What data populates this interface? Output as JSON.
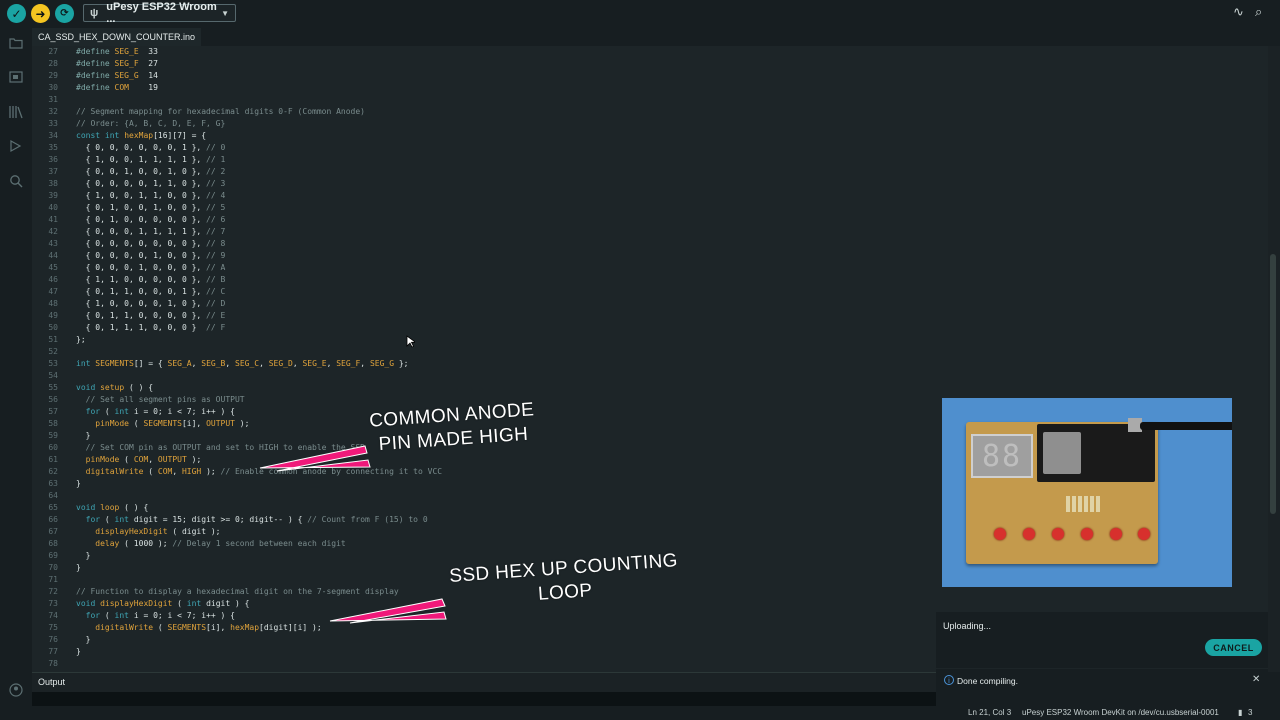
{
  "toolbar": {
    "verify_icon": "check-icon",
    "upload_icon": "arrow-right-icon",
    "debug_icon": "debug-icon",
    "board": "uPesy ESP32 Wroom ...",
    "colors": {
      "verify": "#1aa4a3",
      "upload": "#f5c521",
      "debug": "#1aa4a3"
    }
  },
  "tab": {
    "filename": "CA_SSD_HEX_DOWN_COUNTER.ino"
  },
  "code": {
    "lines": [
      {
        "n": "27",
        "t": "#define SEG_E  33"
      },
      {
        "n": "28",
        "t": "#define SEG_F  27"
      },
      {
        "n": "29",
        "t": "#define SEG_G  14"
      },
      {
        "n": "30",
        "t": "#define COM    19"
      },
      {
        "n": "31",
        "t": ""
      },
      {
        "n": "32",
        "t": "// Segment mapping for hexadecimal digits 0-F (Common Anode)"
      },
      {
        "n": "33",
        "t": "// Order: {A, B, C, D, E, F, G}"
      },
      {
        "n": "34",
        "t": "const int hexMap[16][7] = {"
      },
      {
        "n": "35",
        "t": "  { 0, 0, 0, 0, 0, 0, 1 }, // 0"
      },
      {
        "n": "36",
        "t": "  { 1, 0, 0, 1, 1, 1, 1 }, // 1"
      },
      {
        "n": "37",
        "t": "  { 0, 0, 1, 0, 0, 1, 0 }, // 2"
      },
      {
        "n": "38",
        "t": "  { 0, 0, 0, 0, 1, 1, 0 }, // 3"
      },
      {
        "n": "39",
        "t": "  { 1, 0, 0, 1, 1, 0, 0 }, // 4"
      },
      {
        "n": "40",
        "t": "  { 0, 1, 0, 0, 1, 0, 0 }, // 5"
      },
      {
        "n": "41",
        "t": "  { 0, 1, 0, 0, 0, 0, 0 }, // 6"
      },
      {
        "n": "42",
        "t": "  { 0, 0, 0, 1, 1, 1, 1 }, // 7"
      },
      {
        "n": "43",
        "t": "  { 0, 0, 0, 0, 0, 0, 0 }, // 8"
      },
      {
        "n": "44",
        "t": "  { 0, 0, 0, 0, 1, 0, 0 }, // 9"
      },
      {
        "n": "45",
        "t": "  { 0, 0, 0, 1, 0, 0, 0 }, // A"
      },
      {
        "n": "46",
        "t": "  { 1, 1, 0, 0, 0, 0, 0 }, // B"
      },
      {
        "n": "47",
        "t": "  { 0, 1, 1, 0, 0, 0, 1 }, // C"
      },
      {
        "n": "48",
        "t": "  { 1, 0, 0, 0, 0, 1, 0 }, // D"
      },
      {
        "n": "49",
        "t": "  { 0, 1, 1, 0, 0, 0, 0 }, // E"
      },
      {
        "n": "50",
        "t": "  { 0, 1, 1, 1, 0, 0, 0 }  // F"
      },
      {
        "n": "51",
        "t": "};"
      },
      {
        "n": "52",
        "t": ""
      },
      {
        "n": "53",
        "t": "int SEGMENTS[] = { SEG_A, SEG_B, SEG_C, SEG_D, SEG_E, SEG_F, SEG_G };"
      },
      {
        "n": "54",
        "t": ""
      },
      {
        "n": "55",
        "t": "void setup ( ) {"
      },
      {
        "n": "56",
        "t": "  // Set all segment pins as OUTPUT"
      },
      {
        "n": "57",
        "t": "  for ( int i = 0; i < 7; i++ ) {"
      },
      {
        "n": "58",
        "t": "    pinMode ( SEGMENTS[i], OUTPUT );"
      },
      {
        "n": "59",
        "t": "  }"
      },
      {
        "n": "60",
        "t": "  // Set COM pin as OUTPUT and set to HIGH to enable the SSD"
      },
      {
        "n": "61",
        "t": "  pinMode ( COM, OUTPUT );"
      },
      {
        "n": "62",
        "t": "  digitalWrite ( COM, HIGH ); // Enable common anode by connecting it to VCC"
      },
      {
        "n": "63",
        "t": "}"
      },
      {
        "n": "64",
        "t": ""
      },
      {
        "n": "65",
        "t": "void loop ( ) {"
      },
      {
        "n": "66",
        "t": "  for ( int digit = 15; digit >= 0; digit-- ) { // Count from F (15) to 0"
      },
      {
        "n": "67",
        "t": "    displayHexDigit ( digit );"
      },
      {
        "n": "68",
        "t": "    delay ( 1000 ); // Delay 1 second between each digit"
      },
      {
        "n": "69",
        "t": "  }"
      },
      {
        "n": "70",
        "t": "}"
      },
      {
        "n": "71",
        "t": ""
      },
      {
        "n": "72",
        "t": "// Function to display a hexadecimal digit on the 7-segment display"
      },
      {
        "n": "73",
        "t": "void displayHexDigit ( int digit ) {"
      },
      {
        "n": "74",
        "t": "  for ( int i = 0; i < 7; i++ ) {"
      },
      {
        "n": "75",
        "t": "    digitalWrite ( SEGMENTS[i], hexMap[digit][i] );"
      },
      {
        "n": "76",
        "t": "  }"
      },
      {
        "n": "77",
        "t": "}"
      },
      {
        "n": "78",
        "t": ""
      }
    ]
  },
  "annotations": {
    "anode_line1": "COMMON ANODE",
    "anode_line2": "PIN MADE HIGH",
    "loop_line1": "SSD HEX UP COUNTING",
    "loop_line2": "LOOP"
  },
  "output": {
    "label": "Output"
  },
  "notification": {
    "uploading": "Uploading...",
    "cancel": "CANCEL",
    "done": "Done compiling."
  },
  "status": {
    "position": "Ln 21, Col 3",
    "board": "uPesy ESP32 Wroom DevKit on /dev/cu.usbserial-0001",
    "notifications": "3"
  },
  "photo": {
    "display_digits": "88"
  }
}
